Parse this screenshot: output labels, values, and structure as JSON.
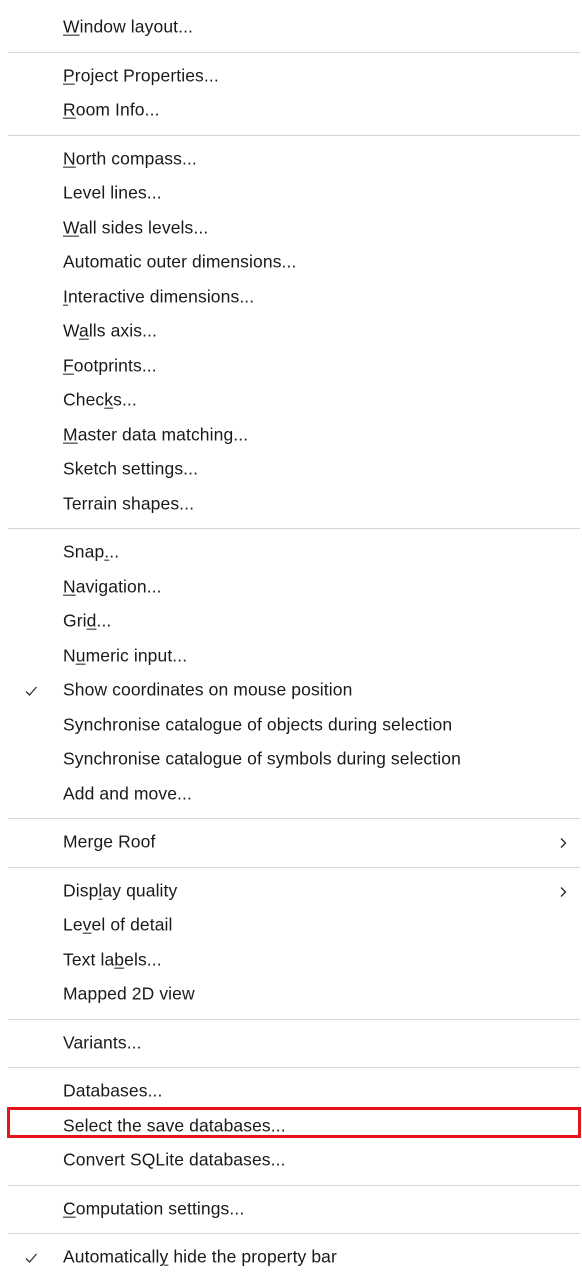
{
  "menu": {
    "groups": [
      [
        {
          "label": "Window layout...",
          "ul": 0
        }
      ],
      [
        {
          "label": "Project Properties...",
          "ul": 0
        },
        {
          "label": "Room Info...",
          "ul": 0
        }
      ],
      [
        {
          "label": "North compass...",
          "ul": 0
        },
        {
          "label": "Level lines...",
          "ul": -1
        },
        {
          "label": "Wall sides levels...",
          "ul": 0
        },
        {
          "label": "Automatic outer dimensions...",
          "ul": -1
        },
        {
          "label": "Interactive dimensions...",
          "ul": 0
        },
        {
          "label": "Walls axis...",
          "ul": 1
        },
        {
          "label": "Footprints...",
          "ul": 0
        },
        {
          "label": "Checks...",
          "ul": 4
        },
        {
          "label": "Master data matching...",
          "ul": 0
        },
        {
          "label": "Sketch settings...",
          "ul": -1
        },
        {
          "label": "Terrain shapes...",
          "ul": -1
        }
      ],
      [
        {
          "label": "Snap...",
          "ul": 4
        },
        {
          "label": "Navigation...",
          "ul": 0
        },
        {
          "label": "Grid...",
          "ul": 3
        },
        {
          "label": "Numeric input...",
          "ul": 1
        },
        {
          "label": "Show coordinates on mouse position",
          "ul": -1,
          "checked": true
        },
        {
          "label": "Synchronise catalogue of objects during selection",
          "ul": -1
        },
        {
          "label": "Synchronise catalogue of symbols during selection",
          "ul": -1
        },
        {
          "label": "Add and move...",
          "ul": -1
        }
      ],
      [
        {
          "label": "Merge Roof",
          "ul": -1,
          "submenu": true
        }
      ],
      [
        {
          "label": "Display quality",
          "ul": 4,
          "submenu": true
        },
        {
          "label": "Level of detail",
          "ul": 2
        },
        {
          "label": "Text labels...",
          "ul": 7
        },
        {
          "label": "Mapped 2D view",
          "ul": -1
        }
      ],
      [
        {
          "label": "Variants...",
          "ul": -1
        }
      ],
      [
        {
          "label": "Databases...",
          "ul": -1
        },
        {
          "label": "Select the save databases...",
          "ul": -1
        },
        {
          "label": "Convert SQLite databases...",
          "ul": -1
        }
      ],
      [
        {
          "label": "Computation settings...",
          "ul": 0
        }
      ],
      [
        {
          "label": "Automatically hide the property bar",
          "ul": 12,
          "checked": true
        }
      ]
    ]
  },
  "colors": {
    "highlight_border": "#e8141b",
    "separator": "#d4d4d4",
    "text": "#1a1a1a"
  },
  "icons": {
    "check": "checkmark-icon",
    "submenu": "chevron-right-icon"
  }
}
